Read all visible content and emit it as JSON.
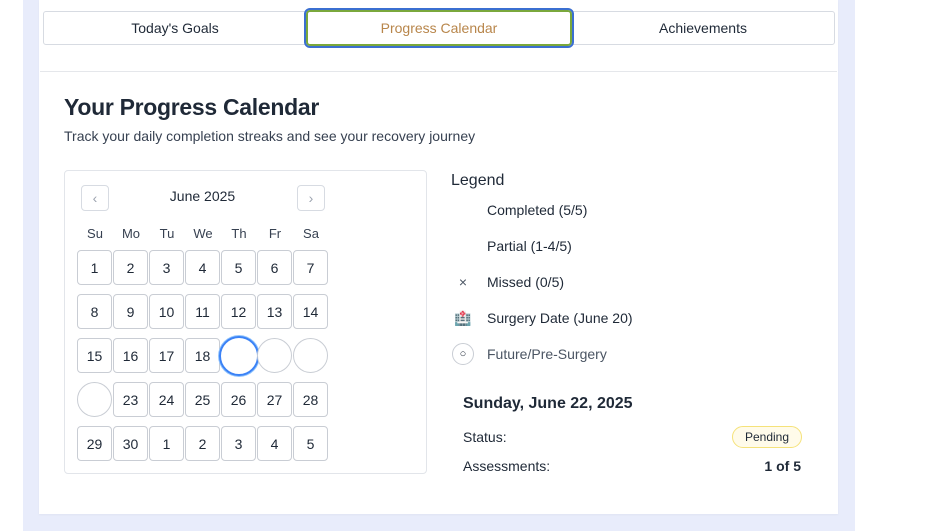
{
  "tabs": [
    {
      "label": "Today's Goals"
    },
    {
      "label": "Progress Calendar"
    },
    {
      "label": "Achievements"
    }
  ],
  "header": {
    "title": "Your Progress Calendar",
    "subtitle": "Track your daily completion streaks and see your recovery journey"
  },
  "calendar": {
    "month_label": "June 2025",
    "prev_icon": "‹",
    "next_icon": "›",
    "weekdays": [
      "Su",
      "Mo",
      "Tu",
      "We",
      "Th",
      "Fr",
      "Sa"
    ],
    "rows": [
      [
        "1",
        "2",
        "3",
        "4",
        "5",
        "6",
        "7"
      ],
      [
        "8",
        "9",
        "10",
        "11",
        "12",
        "13",
        "14"
      ],
      [
        "15",
        "16",
        "17",
        "18",
        "",
        "",
        ""
      ],
      [
        "",
        "23",
        "24",
        "25",
        "26",
        "27",
        "28"
      ],
      [
        "29",
        "30",
        "1",
        "2",
        "3",
        "4",
        "5"
      ]
    ]
  },
  "legend": {
    "title": "Legend",
    "items": [
      {
        "label": "Completed (5/5)",
        "icon": ""
      },
      {
        "label": "Partial (1-4/5)",
        "icon": ""
      },
      {
        "label": "Missed (0/5)",
        "icon": "×"
      },
      {
        "label": "Surgery Date (June 20)",
        "icon": "🏥"
      },
      {
        "label": "Future/Pre-Surgery",
        "icon": "○"
      }
    ]
  },
  "detail": {
    "date": "Sunday, June 22, 2025",
    "status_label": "Status:",
    "status_value": "Pending",
    "assessments_label": "Assessments:",
    "assessments_value": "1 of 5"
  }
}
